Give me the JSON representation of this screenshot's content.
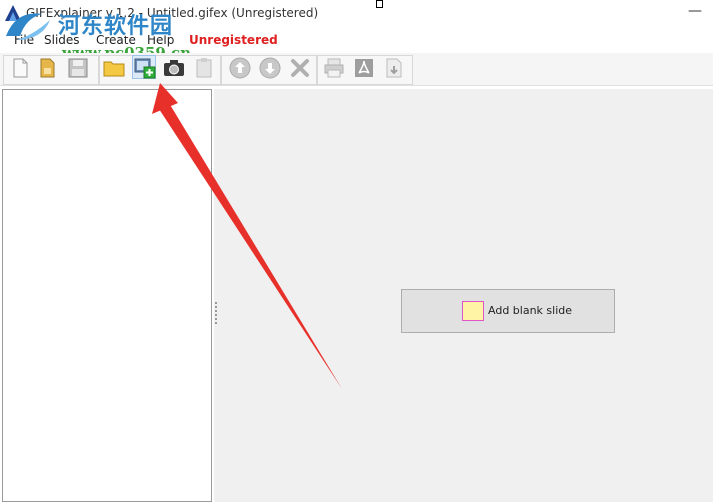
{
  "window": {
    "title": "GIFExplainer v.1.2 - Untitled.gifex (Unregistered)",
    "minimize_glyph": "—"
  },
  "watermark": {
    "title": "河东软件园",
    "url": "www.pc0359.cn"
  },
  "menu": {
    "items": [
      "File",
      "Slides",
      "Create",
      "Help"
    ],
    "unregistered": "Unregistered"
  },
  "toolbar": {
    "buttons": [
      {
        "icon": "new-file-icon"
      },
      {
        "icon": "open-file-icon"
      },
      {
        "icon": "save-icon"
      },
      {
        "icon": "folder-icon"
      },
      {
        "icon": "add-image-icon",
        "active": true
      },
      {
        "icon": "camera-icon"
      },
      {
        "icon": "clipboard-icon"
      },
      {
        "icon": "move-up-icon"
      },
      {
        "icon": "move-down-icon"
      },
      {
        "icon": "delete-icon"
      },
      {
        "icon": "print-icon"
      },
      {
        "icon": "pdf-icon"
      },
      {
        "icon": "export-icon"
      }
    ]
  },
  "main": {
    "add_blank_label": "Add blank slide"
  },
  "colors": {
    "accent_red": "#e02020",
    "watermark_blue": "#2e86c8",
    "watermark_green": "#3aa33a",
    "arrow_red": "#e8302a"
  }
}
